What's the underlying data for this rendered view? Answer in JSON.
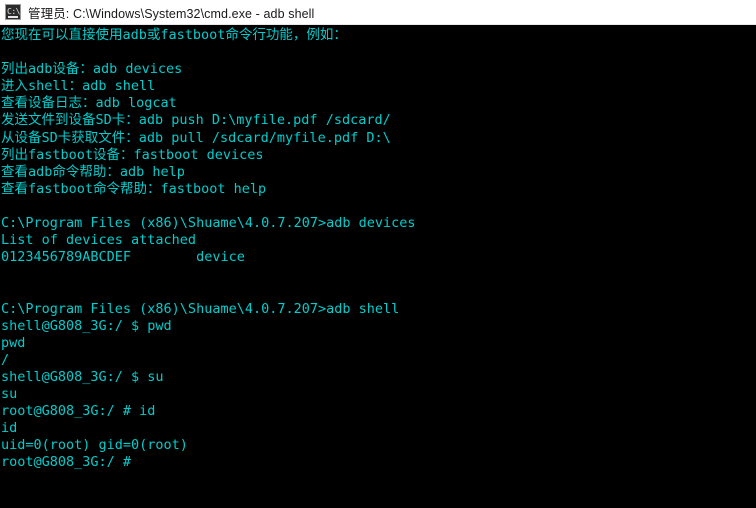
{
  "window": {
    "titlebar": {
      "icon_name": "cmd-console-icon",
      "icon_glyph": "C:\\",
      "title": "管理员: C:\\Windows\\System32\\cmd.exe - adb  shell"
    },
    "colors": {
      "titlebar_background": "#ffffff",
      "titlebar_text": "#1a1a1a",
      "console_background": "#000000",
      "console_text": "#00cdcd"
    }
  },
  "console": {
    "lines": [
      "您现在可以直接使用adb或fastboot命令行功能，例如：",
      "",
      "列出adb设备：adb devices",
      "进入shell：adb shell",
      "查看设备日志：adb logcat",
      "发送文件到设备SD卡：adb push D:\\myfile.pdf /sdcard/",
      "从设备SD卡获取文件：adb pull /sdcard/myfile.pdf D:\\",
      "列出fastboot设备：fastboot devices",
      "查看adb命令帮助：adb help",
      "查看fastboot命令帮助：fastboot help",
      "",
      "C:\\Program Files (x86)\\Shuame\\4.0.7.207>adb devices",
      "List of devices attached",
      "0123456789ABCDEF        device",
      "",
      "",
      "C:\\Program Files (x86)\\Shuame\\4.0.7.207>adb shell",
      "shell@G808_3G:/ $ pwd",
      "pwd",
      "/",
      "shell@G808_3G:/ $ su",
      "su",
      "root@G808_3G:/ # id",
      "id",
      "uid=0(root) gid=0(root)",
      "root@G808_3G:/ #"
    ]
  }
}
